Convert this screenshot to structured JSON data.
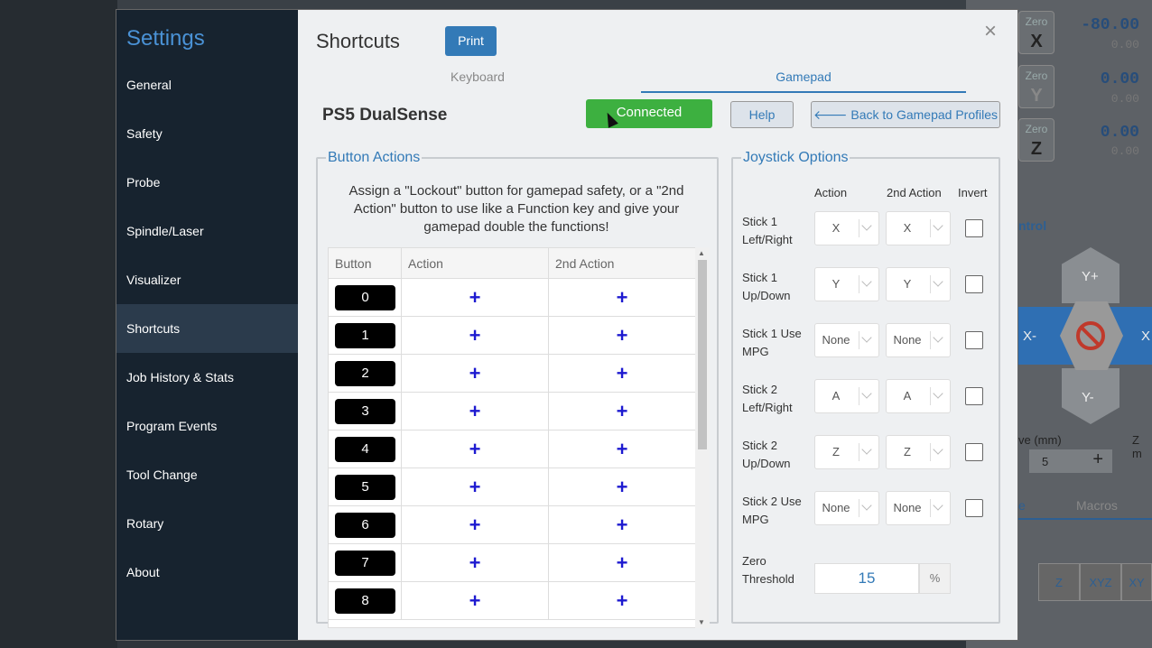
{
  "background": {
    "axes": [
      {
        "zero": "Zero",
        "label": "X",
        "value": "-80.00",
        "sub": "0.00"
      },
      {
        "zero": "Zero",
        "label": "Y",
        "value": "0.00",
        "sub": "0.00"
      },
      {
        "zero": "Zero",
        "label": "Z",
        "value": "0.00",
        "sub": "0.00"
      }
    ],
    "jog_title": "ntrol",
    "jog_up": "Y+",
    "jog_down": "Y-",
    "jog_left": "X-",
    "jog_right": "X",
    "move_label": "ve (mm)",
    "move_value": "5",
    "z_label": "Z m",
    "tab_be": "e",
    "tab_macros": "Macros",
    "view_buttons": [
      "Z",
      "XYZ",
      "XY"
    ]
  },
  "sidebar": {
    "title": "Settings",
    "items": [
      {
        "label": "General"
      },
      {
        "label": "Safety"
      },
      {
        "label": "Probe"
      },
      {
        "label": "Spindle/Laser"
      },
      {
        "label": "Visualizer"
      },
      {
        "label": "Shortcuts"
      },
      {
        "label": "Job History & Stats"
      },
      {
        "label": "Program Events"
      },
      {
        "label": "Tool Change"
      },
      {
        "label": "Rotary"
      },
      {
        "label": "About"
      }
    ],
    "active_index": 5
  },
  "header": {
    "title": "Shortcuts",
    "print_label": "Print",
    "close_glyph": "×"
  },
  "tabs": [
    {
      "label": "Keyboard"
    },
    {
      "label": "Gamepad",
      "active": true
    }
  ],
  "device": {
    "name": "PS5 DualSense",
    "status_label": "Connected",
    "status_color": "#3db040",
    "help_label": "Help",
    "back_label": "🡐 Back to Gamepad Profiles"
  },
  "button_actions": {
    "legend": "Button Actions",
    "description": "Assign a \"Lockout\" button for gamepad safety, or a \"2nd Action\" button to use like a Function key and give your gamepad double the functions!",
    "columns": [
      "Button",
      "Action",
      "2nd Action"
    ],
    "rows": [
      "0",
      "1",
      "2",
      "3",
      "4",
      "5",
      "6",
      "7",
      "8"
    ],
    "add_glyph": "+"
  },
  "joystick_options": {
    "legend": "Joystick Options",
    "columns": [
      "Action",
      "2nd Action",
      "Invert"
    ],
    "rows": [
      {
        "label": "Stick 1 Left/Right",
        "action": "X",
        "second": "X",
        "invert": false
      },
      {
        "label": "Stick 1 Up/Down",
        "action": "Y",
        "second": "Y",
        "invert": false
      },
      {
        "label": "Stick 1 Use MPG",
        "action": "None",
        "second": "None",
        "invert": false
      },
      {
        "label": "Stick 2 Left/Right",
        "action": "A",
        "second": "A",
        "invert": false
      },
      {
        "label": "Stick 2 Up/Down",
        "action": "Z",
        "second": "Z",
        "invert": false
      },
      {
        "label": "Stick 2 Use MPG",
        "action": "None",
        "second": "None",
        "invert": false
      }
    ],
    "threshold_label": "Zero Threshold",
    "threshold_value": "15",
    "threshold_unit": "%"
  }
}
